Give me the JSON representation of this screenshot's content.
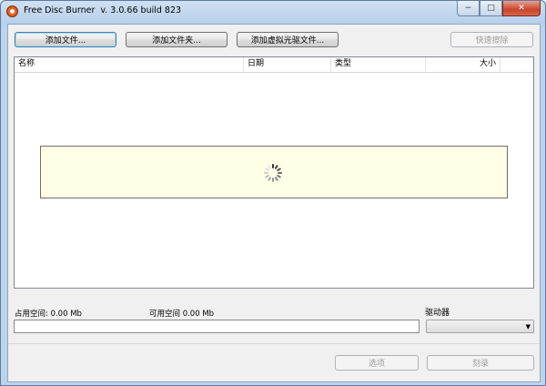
{
  "window": {
    "app_name": "Free Disc Burner",
    "version": "v. 3.0.66 build 823"
  },
  "toolbar": {
    "add_files": "添加文件...",
    "add_folder": "添加文件夹...",
    "add_virtual_drive_files": "添加虚拟光驱文件...",
    "quick_erase": "快速擦除"
  },
  "file_list": {
    "columns": [
      "名称",
      "日期",
      "类型",
      "大小"
    ],
    "rows": []
  },
  "status": {
    "used_space": "占用空间: 0.00 Mb",
    "free_space": "可用空间 0.00 Mb",
    "burn_progress": 0
  },
  "drive": {
    "label": "驱动器",
    "selected": ""
  },
  "footer": {
    "options": "选项",
    "burn": "刻录"
  },
  "colors": {
    "loading_panel": "#ffffe6",
    "title_bar": "#bcd3ec"
  }
}
